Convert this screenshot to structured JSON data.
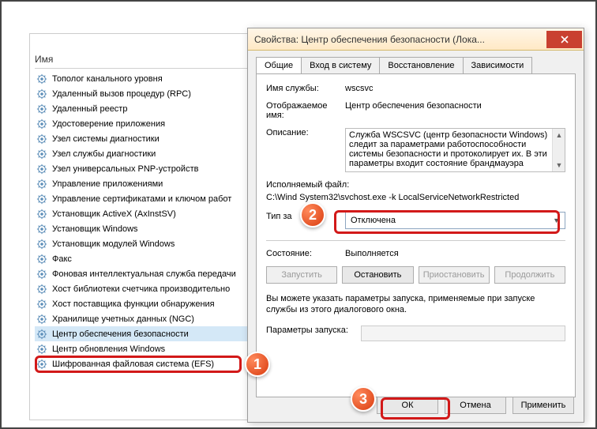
{
  "bg": {
    "column_header": "Имя",
    "services": [
      "Тополог канального уровня",
      "Удаленный вызов процедур (RPC)",
      "Удаленный реестр",
      "Удостоверение приложения",
      "Узел системы диагностики",
      "Узел службы диагностики",
      "Узел универсальных PNP-устройств",
      "Управление приложениями",
      "Управление сертификатами и ключом работ",
      "Установщик ActiveX (AxInstSV)",
      "Установщик Windows",
      "Установщик модулей Windows",
      "Факс",
      "Фоновая интеллектуальная служба передачи",
      "Хост библиотеки счетчика производительно",
      "Хост поставщика функции обнаружения",
      "Хранилище учетных данных (NGC)",
      "Центр обеспечения безопасности",
      "Центр обновления Windows",
      "Шифрованная файловая система (EFS)"
    ],
    "selected_index": 17
  },
  "dialog": {
    "title": "Свойства: Центр обеспечения безопасности (Лока...",
    "tabs": [
      "Общие",
      "Вход в систему",
      "Восстановление",
      "Зависимости"
    ],
    "labels": {
      "service_name": "Имя службы:",
      "display_name": "Отображаемое имя:",
      "description": "Описание:",
      "exe": "Исполняемый файл:",
      "startup_type": "Тип за",
      "status": "Состояние:",
      "params": "Параметры запуска:"
    },
    "values": {
      "service_name": "wscsvc",
      "display_name": "Центр обеспечения безопасности",
      "description": "Служба WSCSVC (центр безопасности Windows) следит за параметрами работоспособности системы безопасности и протоколирует их. В эти параметры входит состояние брандмауэра",
      "exe": "C:\\Wind        System32\\svchost.exe -k LocalServiceNetworkRestricted",
      "startup_type": "Отключена",
      "status": "Выполняется"
    },
    "buttons": {
      "start": "Запустить",
      "stop": "Остановить",
      "pause": "Приостановить",
      "resume": "Продолжить",
      "ok": "ОК",
      "cancel": "Отмена",
      "apply": "Применить"
    },
    "hint": "Вы можете указать параметры запуска, применяемые при запуске службы из этого диалогового окна."
  },
  "badges": {
    "b1": "1",
    "b2": "2",
    "b3": "3"
  }
}
